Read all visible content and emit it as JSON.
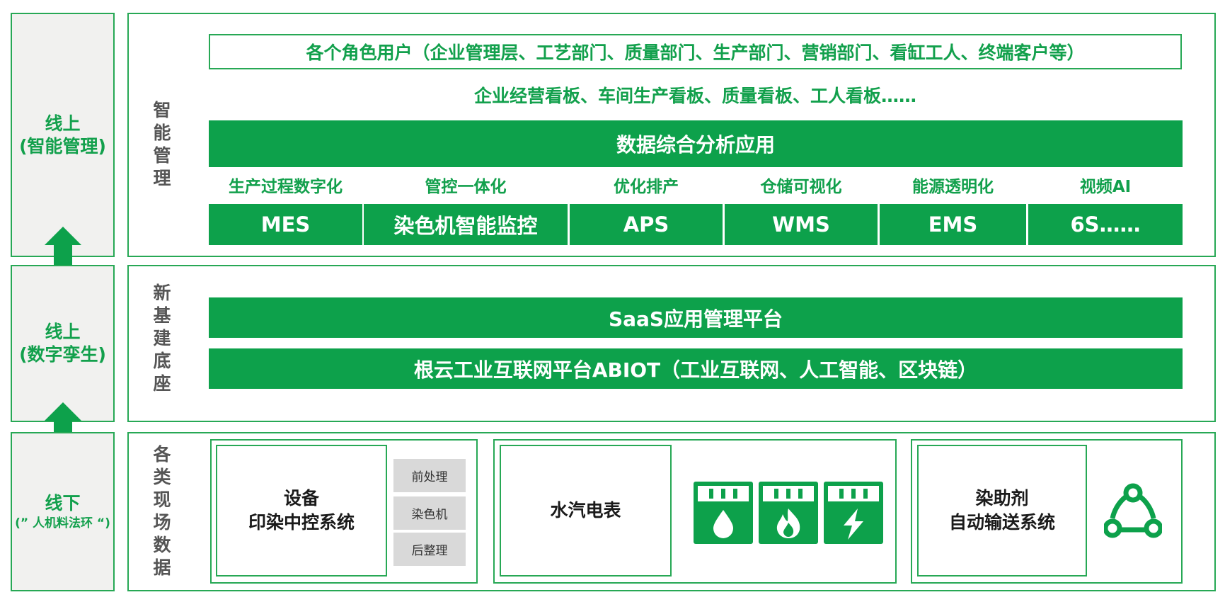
{
  "left": {
    "top": {
      "title": "线上",
      "sub": "(智能管理)"
    },
    "mid": {
      "title": "线上",
      "sub": "(数字孪生)"
    },
    "bot": {
      "title": "线下",
      "sub": "(” 人机料法环 “)"
    }
  },
  "intelligent": {
    "label": "智能管理",
    "roles": "各个角色用户（企业管理层、工艺部门、质量部门、生产部门、营销部门、看缸工人、终端客户等）",
    "boards": "企业经营看板、车间生产看板、质量看板、工人看板……",
    "analysis": "数据综合分析应用",
    "categories": [
      "生产过程数字化",
      "管控一体化",
      "优化排产",
      "仓储可视化",
      "能源透明化",
      "视频AI"
    ],
    "systems": [
      "MES",
      "染色机智能监控",
      "APS",
      "WMS",
      "EMS",
      "6S……"
    ]
  },
  "infra": {
    "label": "新基建底座",
    "saas": "SaaS应用管理平台",
    "abiot": "根云工业互联网平台ABIOT（工业互联网、人工智能、区块链）"
  },
  "field": {
    "label": "各类现场数据",
    "device": {
      "line1": "设备",
      "line2": "印染中控系统",
      "items": [
        "前处理",
        "染色机",
        "后整理"
      ]
    },
    "meters": {
      "title": "水汽电表",
      "icons": [
        "water-drop-icon",
        "flame-icon",
        "lightning-icon"
      ]
    },
    "dye": {
      "line1": "染助剂",
      "line2": "自动输送系统",
      "icon": "cycle-nodes-icon"
    }
  },
  "colors": {
    "green": "#0da14b",
    "border": "#27a855",
    "gray": "#d9d9d9",
    "leftBg": "#f1f1ef"
  }
}
